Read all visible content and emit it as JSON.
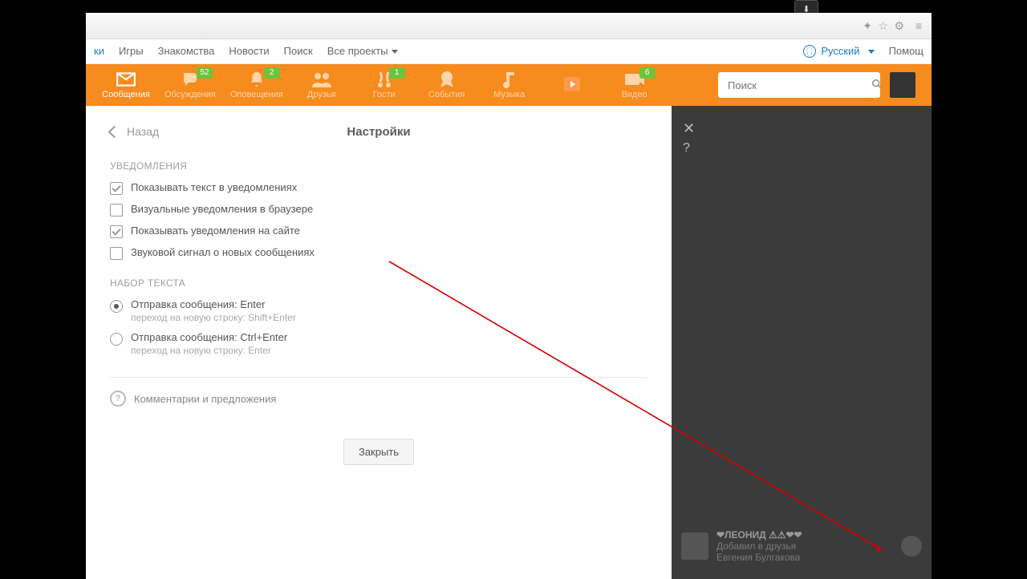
{
  "browser": {
    "download_indicator": "⬇"
  },
  "topnav": {
    "truncated_first": "ки",
    "items": [
      "Игры",
      "Знакомства",
      "Новости",
      "Поиск",
      "Все проекты"
    ],
    "language": "Русский",
    "help": "Помощ"
  },
  "tabs": [
    {
      "id": "messages",
      "label": "Сообщения",
      "badge": null,
      "active": true
    },
    {
      "id": "discussions",
      "label": "Обсуждения",
      "badge": "52",
      "active": false
    },
    {
      "id": "notifications",
      "label": "Оповещения",
      "badge": "2",
      "active": false
    },
    {
      "id": "friends",
      "label": "Друзья",
      "badge": null,
      "active": false
    },
    {
      "id": "guests",
      "label": "Гости",
      "badge": "1",
      "active": false
    },
    {
      "id": "events",
      "label": "События",
      "badge": null,
      "active": false
    },
    {
      "id": "music",
      "label": "Музыка",
      "badge": null,
      "active": false
    },
    {
      "id": "play",
      "label": "",
      "badge": null,
      "active": false
    },
    {
      "id": "video",
      "label": "Видео",
      "badge": "6",
      "active": false
    }
  ],
  "search": {
    "placeholder": "Поиск"
  },
  "panel": {
    "back": "Назад",
    "title": "Настройки",
    "section_notifications": "УВЕДОМЛЕНИЯ",
    "opts": [
      {
        "label": "Показывать текст в уведомлениях",
        "checked": true
      },
      {
        "label": "Визуальные уведомления в браузере",
        "checked": false
      },
      {
        "label": "Показывать уведомления на сайте",
        "checked": true
      },
      {
        "label": "Звуковой сигнал о новых сообщениях",
        "checked": false
      }
    ],
    "section_typing": "НАБОР ТЕКСТА",
    "radios": [
      {
        "label": "Отправка сообщения: Enter",
        "sub": "переход на новую строку: Shift+Enter",
        "selected": true
      },
      {
        "label": "Отправка сообщения: Ctrl+Enter",
        "sub": "переход на новую строку: Enter",
        "selected": false
      }
    ],
    "feedback": "Комментарии и предложения",
    "close": "Закрыть"
  },
  "side": {
    "close": "✕",
    "help": "?"
  },
  "feed": {
    "name": "❤ЛЕОНИД ⚠⚠❤❤",
    "action": "Добавил в друзья",
    "who": "Евгения Булгакова"
  }
}
